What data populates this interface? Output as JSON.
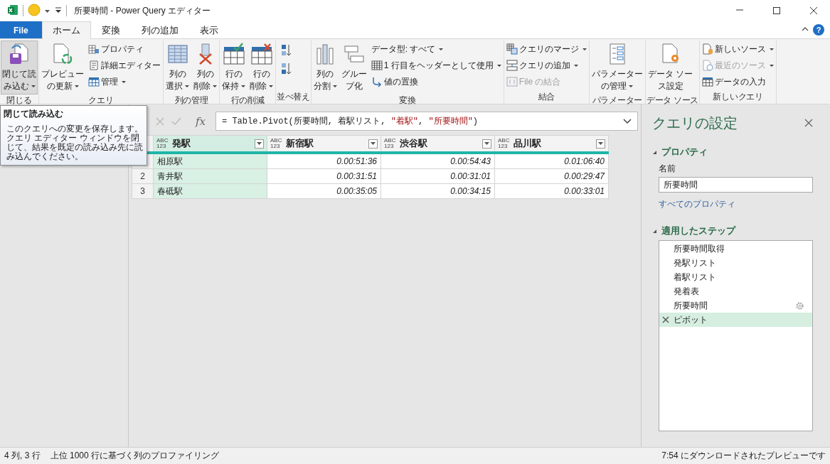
{
  "window": {
    "title": "所要時間 - Power Query エディター"
  },
  "tabs": [
    {
      "label": "File",
      "kind": "file",
      "selected": false
    },
    {
      "label": "ホーム",
      "kind": "tab",
      "selected": true
    },
    {
      "label": "変換",
      "kind": "tab",
      "selected": false
    },
    {
      "label": "列の追加",
      "kind": "tab",
      "selected": false
    },
    {
      "label": "表示",
      "kind": "tab",
      "selected": false
    }
  ],
  "help_label": "?",
  "ribbon": {
    "groups": [
      {
        "label": "閉じる",
        "items": [
          {
            "kind": "large",
            "lines": [
              "閉じて読",
              "み込む"
            ],
            "dropdown": true,
            "selected": true
          }
        ]
      },
      {
        "label": "クエリ",
        "items": [
          {
            "kind": "large",
            "lines": [
              "プレビュー",
              "の更新"
            ],
            "dropdown": true,
            "selected": false
          },
          {
            "kind": "stack",
            "items": [
              {
                "label": "プロパティ",
                "dropdown": false,
                "disabled": false
              },
              {
                "label": "詳細エディター",
                "dropdown": false,
                "disabled": false
              },
              {
                "label": "管理",
                "dropdown": true,
                "disabled": false
              }
            ]
          }
        ]
      },
      {
        "label": "列の管理",
        "items": [
          {
            "kind": "large",
            "lines": [
              "列の",
              "選択"
            ],
            "dropdown": true,
            "selected": false
          },
          {
            "kind": "large",
            "lines": [
              "列の",
              "削除"
            ],
            "dropdown": true,
            "selected": false
          }
        ]
      },
      {
        "label": "行の削減",
        "items": [
          {
            "kind": "large",
            "lines": [
              "行の",
              "保持"
            ],
            "dropdown": true,
            "selected": false
          },
          {
            "kind": "large",
            "lines": [
              "行の",
              "削除"
            ],
            "dropdown": true,
            "selected": false
          }
        ]
      },
      {
        "label": "並べ替え",
        "items": [
          {
            "kind": "sort"
          }
        ]
      },
      {
        "label": "変換",
        "items": [
          {
            "kind": "large",
            "lines": [
              "列の",
              "分割"
            ],
            "dropdown": true,
            "selected": false
          },
          {
            "kind": "large",
            "lines": [
              "グルー",
              "プ化"
            ],
            "dropdown": false,
            "selected": false
          },
          {
            "kind": "stack",
            "items": [
              {
                "label": "データ型: すべて",
                "dropdown": true,
                "disabled": false
              },
              {
                "label": "1 行目をヘッダーとして使用",
                "dropdown": true,
                "disabled": false
              },
              {
                "label": "値の置換",
                "dropdown": false,
                "disabled": false
              }
            ]
          }
        ]
      },
      {
        "label": "結合",
        "items": [
          {
            "kind": "stack",
            "items": [
              {
                "label": "クエリのマージ",
                "dropdown": true,
                "disabled": false
              },
              {
                "label": "クエリの追加",
                "dropdown": true,
                "disabled": false
              },
              {
                "label": "File の結合",
                "dropdown": false,
                "disabled": true
              }
            ]
          }
        ]
      },
      {
        "label": "パラメーター",
        "items": [
          {
            "kind": "large",
            "lines": [
              "パラメーター",
              "の管理"
            ],
            "dropdown": true,
            "selected": false
          }
        ]
      },
      {
        "label": "データ ソース",
        "items": [
          {
            "kind": "large",
            "lines": [
              "データ ソー",
              "ス設定"
            ],
            "dropdown": false,
            "selected": false
          }
        ]
      },
      {
        "label": "新しいクエリ",
        "items": [
          {
            "kind": "stack",
            "items": [
              {
                "label": "新しいソース",
                "dropdown": true,
                "disabled": false
              },
              {
                "label": "最近のソース",
                "dropdown": true,
                "disabled": true
              },
              {
                "label": "データの入力",
                "dropdown": false,
                "disabled": false
              }
            ]
          }
        ]
      }
    ]
  },
  "tooltip": {
    "title": "閉じて読み込む",
    "text": "このクエリへの変更を保存します。クエリ エディター ウィンドウを閉じて、結果を既定の読み込み先に読み込んでください。"
  },
  "formula": {
    "fx_label": "fx",
    "parts": [
      {
        "text": "= Table.Pivot(所要時間, 着駅リスト, ",
        "kind": "code"
      },
      {
        "text": "\"着駅\"",
        "kind": "string"
      },
      {
        "text": ", ",
        "kind": "code"
      },
      {
        "text": "\"所要時間\"",
        "kind": "string"
      },
      {
        "text": ")",
        "kind": "code"
      }
    ]
  },
  "table": {
    "columns": [
      {
        "type": "ABC\n123",
        "name": "発駅",
        "selected": true
      },
      {
        "type": "ABC\n123",
        "name": "新宿駅",
        "selected": false
      },
      {
        "type": "ABC\n123",
        "name": "渋谷駅",
        "selected": false
      },
      {
        "type": "ABC\n123",
        "name": "品川駅",
        "selected": false
      }
    ],
    "rows": [
      {
        "cells": [
          "相原駅",
          "0.00:51:36",
          "0.00:54:43",
          "0.01:06:40"
        ]
      },
      {
        "number": "2",
        "cells": [
          "青井駅",
          "0.00:31:51",
          "0.00:31:01",
          "0.00:29:47"
        ]
      },
      {
        "number": "3",
        "cells": [
          "春砥駅",
          "0.00:35:05",
          "0.00:34:15",
          "0.00:33:01"
        ]
      }
    ]
  },
  "settings": {
    "title": "クエリの設定",
    "properties_header": "プロパティ",
    "name_label": "名前",
    "name_value": "所要時間",
    "all_properties": "すべてのプロパティ",
    "steps_header": "適用したステップ",
    "steps": [
      {
        "label": "所要時間取得",
        "selected": false,
        "gear": false
      },
      {
        "label": "発駅リスト",
        "selected": false,
        "gear": false
      },
      {
        "label": "着駅リスト",
        "selected": false,
        "gear": false
      },
      {
        "label": "発着表",
        "selected": false,
        "gear": false
      },
      {
        "label": "所要時間",
        "selected": false,
        "gear": true
      },
      {
        "label": "ピボット",
        "selected": true,
        "gear": false
      }
    ]
  },
  "status_bar": {
    "left": [
      "4 列, 3 行",
      "上位 1000 行に基づく列のプロファイリング"
    ],
    "right": "7:54 にダウンロードされたプレビューです"
  }
}
